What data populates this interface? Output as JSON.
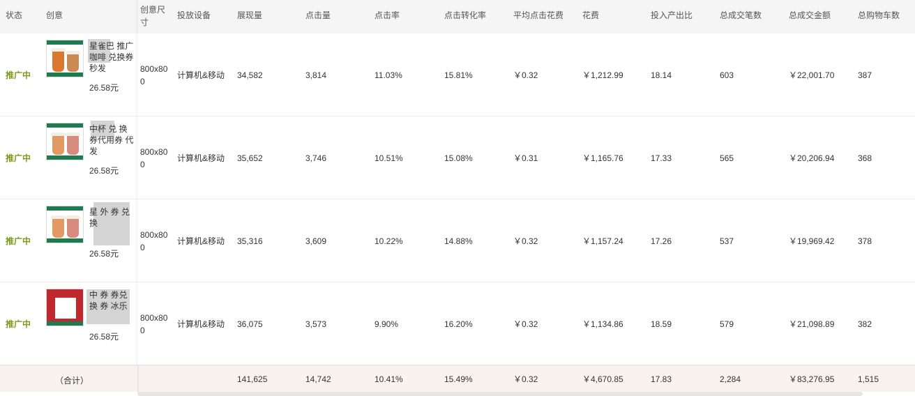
{
  "table": {
    "headers": {
      "status": "状态",
      "creative": "创意",
      "size": "创意尺寸",
      "device": "投放设备",
      "impressions": "展现量",
      "clicks": "点击量",
      "ctr": "点击率",
      "cvr": "点击转化率",
      "cpc": "平均点击花费",
      "cost": "花费",
      "roi": "投入产出比",
      "orders": "总成交笔数",
      "gmv": "总成交金额",
      "carts": "总购物车数"
    },
    "rows": [
      {
        "status": "推广中",
        "creative_text": "星雀巴 推广 咖啡 兑换券秒发",
        "creative_price": "26.58元",
        "size": "800x800",
        "device": "计算机&移动",
        "impressions": "34,582",
        "clicks": "3,814",
        "ctr": "11.03%",
        "cvr": "15.81%",
        "cpc": "￥0.32",
        "cost": "￥1,212.99",
        "roi": "18.14",
        "orders": "603",
        "gmv": "￥22,001.70",
        "carts": "387"
      },
      {
        "status": "推广中",
        "creative_text": "中杯 兑 换券代用券 代 发",
        "creative_price": "26.58元",
        "size": "800x800",
        "device": "计算机&移动",
        "impressions": "35,652",
        "clicks": "3,746",
        "ctr": "10.51%",
        "cvr": "15.08%",
        "cpc": "￥0.31",
        "cost": "￥1,165.76",
        "roi": "17.33",
        "orders": "565",
        "gmv": "￥20,206.94",
        "carts": "368"
      },
      {
        "status": "推广中",
        "creative_text": "星 外 券 兑换 ",
        "creative_price": "26.58元",
        "size": "800x800",
        "device": "计算机&移动",
        "impressions": "35,316",
        "clicks": "3,609",
        "ctr": "10.22%",
        "cvr": "14.88%",
        "cpc": "￥0.32",
        "cost": "￥1,157.24",
        "roi": "17.26",
        "orders": "537",
        "gmv": "￥19,969.42",
        "carts": "378"
      },
      {
        "status": "推广中",
        "creative_text": "中 券 券兑换 券 冰乐",
        "creative_price": "26.58元",
        "size": "800x800",
        "device": "计算机&移动",
        "impressions": "36,075",
        "clicks": "3,573",
        "ctr": "9.90%",
        "cvr": "16.20%",
        "cpc": "￥0.32",
        "cost": "￥1,134.86",
        "roi": "18.59",
        "orders": "579",
        "gmv": "￥21,098.89",
        "carts": "382"
      }
    ],
    "total": {
      "label": "（合计）",
      "impressions": "141,625",
      "clicks": "14,742",
      "ctr": "10.41%",
      "cvr": "15.49%",
      "cpc": "￥0.32",
      "cost": "￥4,670.85",
      "roi": "17.83",
      "orders": "2,284",
      "gmv": "￥83,276.95",
      "carts": "1,515"
    }
  },
  "colors": {
    "status_active": "#7a9a1a",
    "header_bg": "#f5f5f5",
    "total_bg": "#f8f3ee",
    "thumb_green": "#1f7a4f",
    "thumb_red": "#c0282d"
  },
  "icons": [
    "creative-thumbnail-coffee-cups",
    "creative-thumbnail-red-box"
  ]
}
